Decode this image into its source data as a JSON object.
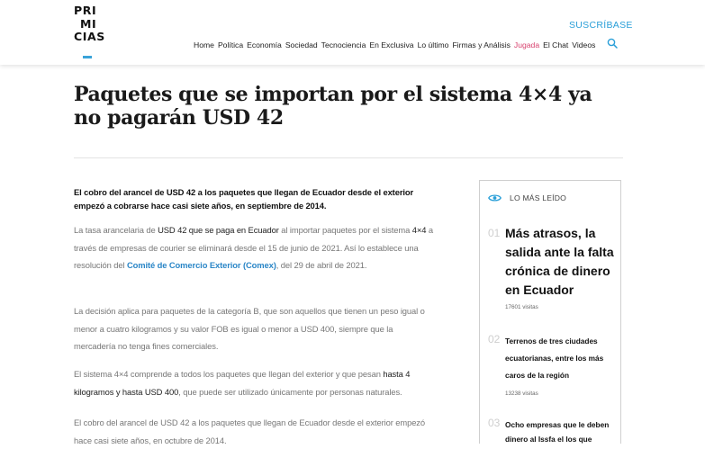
{
  "header": {
    "logo_lines": [
      "PRI",
      "MI",
      "CIAS"
    ],
    "subscribe_label": "SUSCRÍBASE",
    "nav": [
      {
        "label": "Home",
        "accent": false
      },
      {
        "label": "Política",
        "accent": false
      },
      {
        "label": "Economía",
        "accent": false
      },
      {
        "label": "Sociedad",
        "accent": false
      },
      {
        "label": "Tecnociencia",
        "accent": false
      },
      {
        "label": "En Exclusiva",
        "accent": false
      },
      {
        "label": "Lo último",
        "accent": false
      },
      {
        "label": "Firmas y Análisis",
        "accent": false
      },
      {
        "label": "Jugada",
        "accent": true
      },
      {
        "label": "El Chat",
        "accent": false
      },
      {
        "label": "Videos",
        "accent": false
      }
    ],
    "search_icon": "search-icon"
  },
  "article": {
    "title": "Paquetes que se importan por el sistema 4×4 ya no pagarán USD 42",
    "lead": "El cobro del arancel de USD 42 a los paquetes que llegan de Ecuador desde el exterior empezó a cobrarse hace casi siete años, en septiembre de 2014.",
    "p1": {
      "a": "La tasa arancelaria de ",
      "b": "USD 42 que se paga en Ecuador",
      "c": " al importar paquetes por el sistema ",
      "d": "4×4",
      "e": " a través de empresas de courier se eliminará desde el 15 de junio de 2021. Así lo establece una resolución del ",
      "link": "Comité de Comercio Exterior (Comex)",
      "f": ", del 29 de abril de 2021."
    },
    "p2": "La decisión aplica para paquetes de la categoría B, que son aquellos que tienen un peso igual o menor a cuatro kilogramos y su valor FOB es igual o menor a USD 400, siempre que la mercadería no tenga fines comerciales.",
    "p3": {
      "a": "El sistema 4×4 comprende a todos los paquetes que llegan del exterior y que pesan ",
      "b": "hasta 4 kilogramos y hasta USD 400",
      "c": ", que puede ser utilizado únicamente por personas naturales."
    },
    "p4": "El cobro del arancel de USD 42 a los paquetes que llegan de Ecuador desde el exterior empezó hace casi siete años, en octubre de 2014."
  },
  "sidebar": {
    "title": "LO MÁS LEÍDO",
    "icon": "eye-icon",
    "items": [
      {
        "rank": "01",
        "title": "Más atrasos, la salida ante la falta crónica de dinero en Ecuador",
        "views": "17601 visitas"
      },
      {
        "rank": "02",
        "title": "Terrenos de tres ciudades ecuatorianas, entre los más caros de la región",
        "views": "13238 visitas"
      },
      {
        "rank": "03",
        "title": "Ocho empresas que le deben dinero al Issfa el los que",
        "views": ""
      }
    ]
  },
  "colors": {
    "accent_blue": "#2a9fd8",
    "link_blue": "#2a86c7",
    "jugada_pink": "#d8426e"
  }
}
